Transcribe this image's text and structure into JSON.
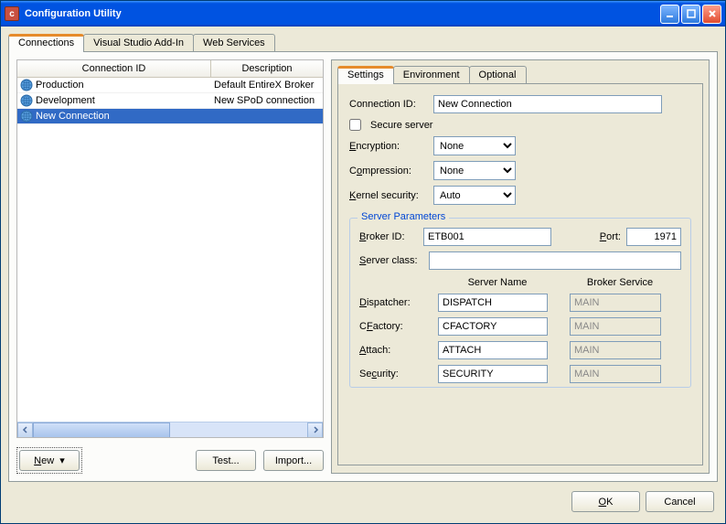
{
  "window": {
    "title": "Configuration Utility"
  },
  "outerTabs": [
    "Connections",
    "Visual Studio Add-In",
    "Web Services"
  ],
  "grid": {
    "columns": [
      "Connection ID",
      "Description"
    ],
    "rows": [
      {
        "id": "Production",
        "desc": "Default EntireX Broker",
        "selected": false
      },
      {
        "id": "Development",
        "desc": "New SPoD connection",
        "selected": false
      },
      {
        "id": "New Connection",
        "desc": "",
        "selected": true
      }
    ]
  },
  "leftButtons": {
    "new": "New",
    "test": "Test...",
    "import": "Import..."
  },
  "innerTabs": [
    "Settings",
    "Environment",
    "Optional"
  ],
  "form": {
    "connectionIdLabel": "Connection ID:",
    "connectionIdValue": "New Connection",
    "secureServerLabel": "Secure server",
    "encryptionLabel": "Encryption:",
    "encryptionValue": "None",
    "compressionLabel": "Compression:",
    "compressionValue": "None",
    "kernelLabel": "Kernel security:",
    "kernelValue": "Auto"
  },
  "serverParams": {
    "legend": "Server Parameters",
    "brokerIdLabel": "Broker ID:",
    "brokerIdValue": "ETB001",
    "portLabel": "Port:",
    "portValue": "1971",
    "serverClassLabel": "Server class:",
    "serverClassValue": "",
    "colServerName": "Server Name",
    "colBrokerService": "Broker Service",
    "rows": [
      {
        "label": "Dispatcher:",
        "name": "DISPATCH",
        "service": "MAIN"
      },
      {
        "label": "CFactory:",
        "name": "CFACTORY",
        "service": "MAIN"
      },
      {
        "label": "Attach:",
        "name": "ATTACH",
        "service": "MAIN"
      },
      {
        "label": "Security:",
        "name": "SECURITY",
        "service": "MAIN"
      }
    ]
  },
  "bottomButtons": {
    "ok": "OK",
    "cancel": "Cancel"
  }
}
